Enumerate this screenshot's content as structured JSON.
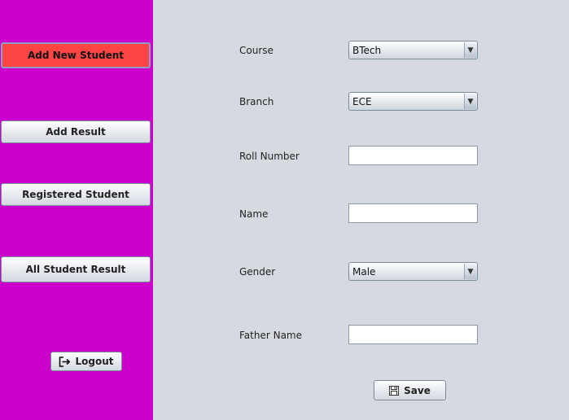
{
  "sidebar": {
    "background": "#cc00cc",
    "active_color": "#ff4444",
    "items": [
      {
        "label": "Add New Student"
      },
      {
        "label": "Add Result"
      },
      {
        "label": "Registered Student"
      },
      {
        "label": "All Student Result"
      }
    ],
    "logout_label": "Logout",
    "logout_icon": "logout-icon"
  },
  "form": {
    "course": {
      "label": "Course",
      "value": "BTech"
    },
    "branch": {
      "label": "Branch",
      "value": "ECE"
    },
    "roll_number": {
      "label": "Roll Number",
      "value": ""
    },
    "name": {
      "label": "Name",
      "value": ""
    },
    "gender": {
      "label": "Gender",
      "value": "Male"
    },
    "father_name": {
      "label": "Father Name",
      "value": ""
    },
    "save_label": "Save",
    "save_icon": "floppy-disk-icon"
  }
}
